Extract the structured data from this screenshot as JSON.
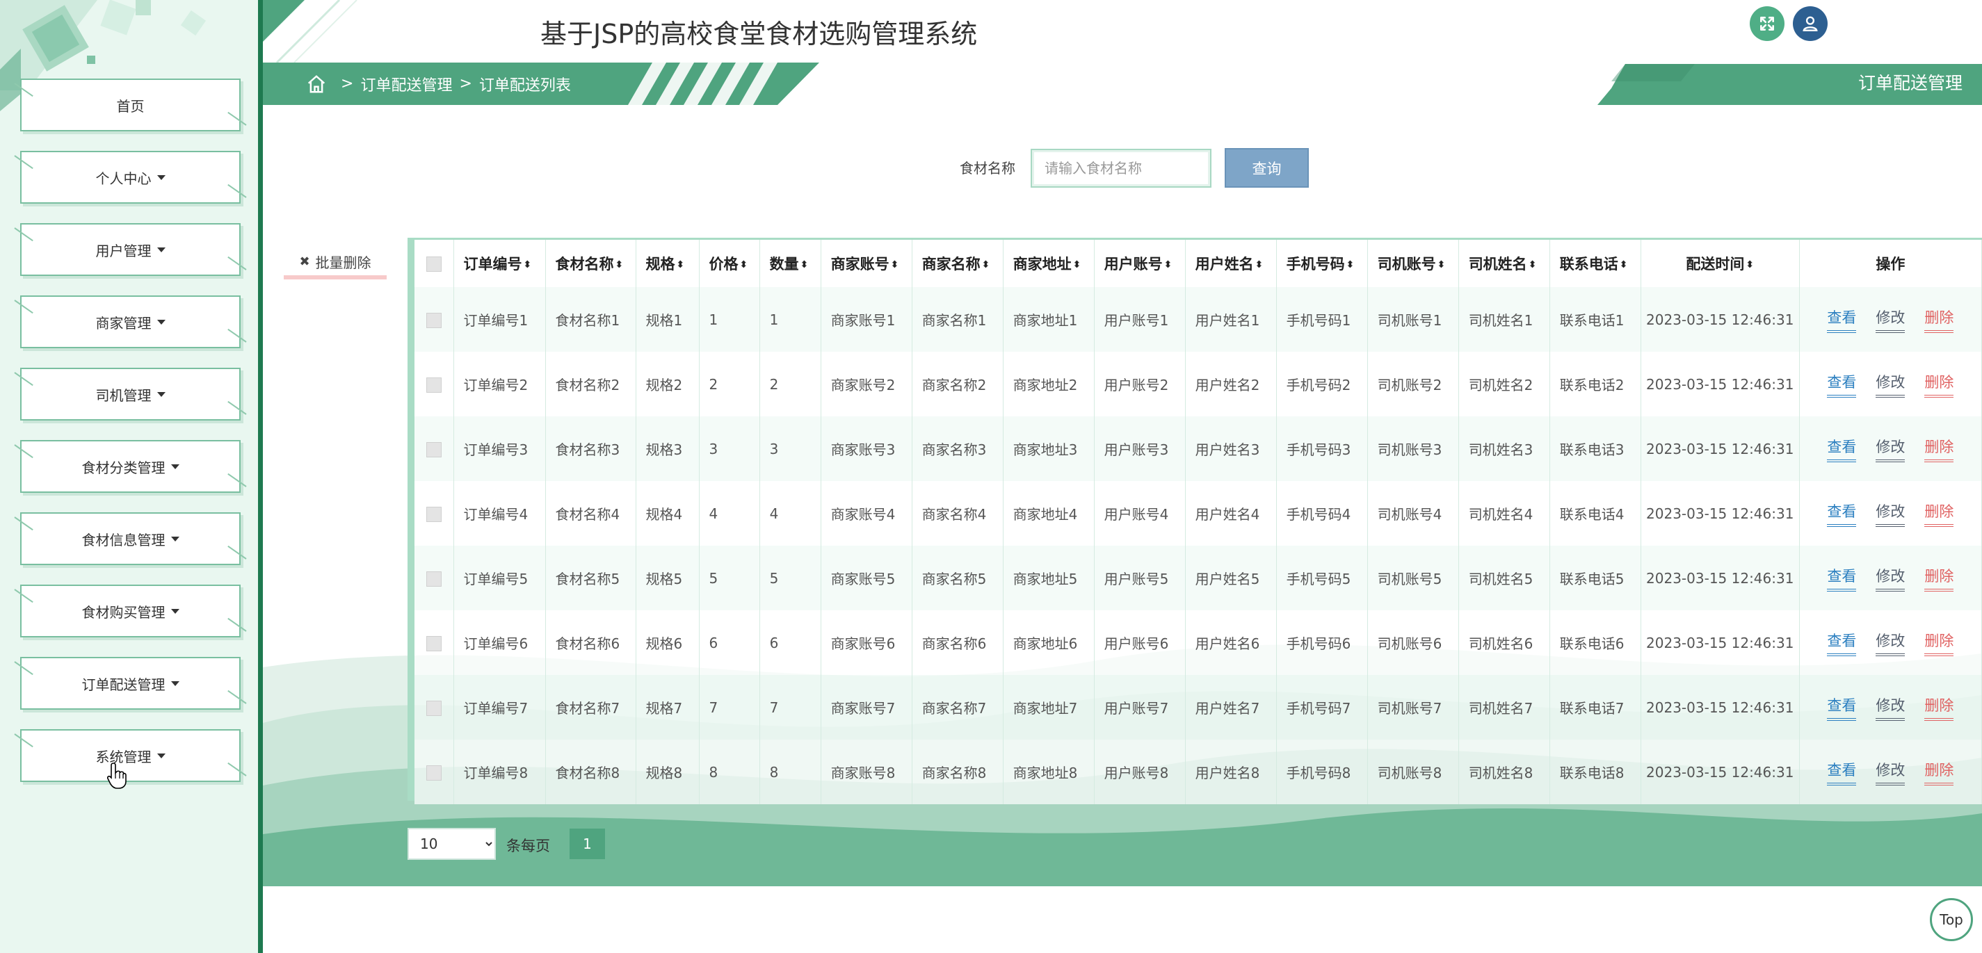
{
  "app": {
    "title": "基于JSP的高校食堂食材选购管理系统"
  },
  "sidebar": {
    "items": [
      {
        "label": "首页",
        "dropdown": false
      },
      {
        "label": "个人中心",
        "dropdown": true
      },
      {
        "label": "用户管理",
        "dropdown": true
      },
      {
        "label": "商家管理",
        "dropdown": true
      },
      {
        "label": "司机管理",
        "dropdown": true
      },
      {
        "label": "食材分类管理",
        "dropdown": true
      },
      {
        "label": "食材信息管理",
        "dropdown": true
      },
      {
        "label": "食材购买管理",
        "dropdown": true
      },
      {
        "label": "订单配送管理",
        "dropdown": true
      },
      {
        "label": "系统管理",
        "dropdown": true
      }
    ]
  },
  "breadcrumb": {
    "separator": ">",
    "items": [
      "订单配送管理",
      "订单配送列表"
    ]
  },
  "section_tab": "订单配送管理",
  "search": {
    "label": "食材名称",
    "placeholder": "请输入食材名称",
    "value": "",
    "button": "查询"
  },
  "batch_delete": "批量删除",
  "table": {
    "columns": [
      "订单编号",
      "食材名称",
      "规格",
      "价格",
      "数量",
      "商家账号",
      "商家名称",
      "商家地址",
      "用户账号",
      "用户姓名",
      "手机号码",
      "司机账号",
      "司机姓名",
      "联系电话",
      "配送时间",
      "操作"
    ],
    "rows": [
      [
        "订单编号1",
        "食材名称1",
        "规格1",
        "1",
        "1",
        "商家账号1",
        "商家名称1",
        "商家地址1",
        "用户账号1",
        "用户姓名1",
        "手机号码1",
        "司机账号1",
        "司机姓名1",
        "联系电话1",
        "2023-03-15 12:46:31"
      ],
      [
        "订单编号2",
        "食材名称2",
        "规格2",
        "2",
        "2",
        "商家账号2",
        "商家名称2",
        "商家地址2",
        "用户账号2",
        "用户姓名2",
        "手机号码2",
        "司机账号2",
        "司机姓名2",
        "联系电话2",
        "2023-03-15 12:46:31"
      ],
      [
        "订单编号3",
        "食材名称3",
        "规格3",
        "3",
        "3",
        "商家账号3",
        "商家名称3",
        "商家地址3",
        "用户账号3",
        "用户姓名3",
        "手机号码3",
        "司机账号3",
        "司机姓名3",
        "联系电话3",
        "2023-03-15 12:46:31"
      ],
      [
        "订单编号4",
        "食材名称4",
        "规格4",
        "4",
        "4",
        "商家账号4",
        "商家名称4",
        "商家地址4",
        "用户账号4",
        "用户姓名4",
        "手机号码4",
        "司机账号4",
        "司机姓名4",
        "联系电话4",
        "2023-03-15 12:46:31"
      ],
      [
        "订单编号5",
        "食材名称5",
        "规格5",
        "5",
        "5",
        "商家账号5",
        "商家名称5",
        "商家地址5",
        "用户账号5",
        "用户姓名5",
        "手机号码5",
        "司机账号5",
        "司机姓名5",
        "联系电话5",
        "2023-03-15 12:46:31"
      ],
      [
        "订单编号6",
        "食材名称6",
        "规格6",
        "6",
        "6",
        "商家账号6",
        "商家名称6",
        "商家地址6",
        "用户账号6",
        "用户姓名6",
        "手机号码6",
        "司机账号6",
        "司机姓名6",
        "联系电话6",
        "2023-03-15 12:46:31"
      ],
      [
        "订单编号7",
        "食材名称7",
        "规格7",
        "7",
        "7",
        "商家账号7",
        "商家名称7",
        "商家地址7",
        "用户账号7",
        "用户姓名7",
        "手机号码7",
        "司机账号7",
        "司机姓名7",
        "联系电话7",
        "2023-03-15 12:46:31"
      ],
      [
        "订单编号8",
        "食材名称8",
        "规格8",
        "8",
        "8",
        "商家账号8",
        "商家名称8",
        "商家地址8",
        "用户账号8",
        "用户姓名8",
        "手机号码8",
        "司机账号8",
        "司机姓名8",
        "联系电话8",
        "2023-03-15 12:46:31"
      ]
    ],
    "actions": {
      "view": "查看",
      "edit": "修改",
      "delete": "删除"
    }
  },
  "pagination": {
    "page_size": "10",
    "page_size_options": [
      "10"
    ],
    "page_size_label": "条每页",
    "current_page": "1"
  },
  "top_button": "Top",
  "icons": {
    "fullscreen": "fullscreen-icon",
    "user": "user-icon",
    "home": "home-icon"
  },
  "colors": {
    "primary": "#4fa47f",
    "sidebar_bg": "#e9f7f0",
    "sidebar_border": "#1e7a50",
    "search_button": "#7ea5c8",
    "user_button": "#2d5f91",
    "view_link": "#2b7fc0",
    "delete_link": "#e06262"
  }
}
